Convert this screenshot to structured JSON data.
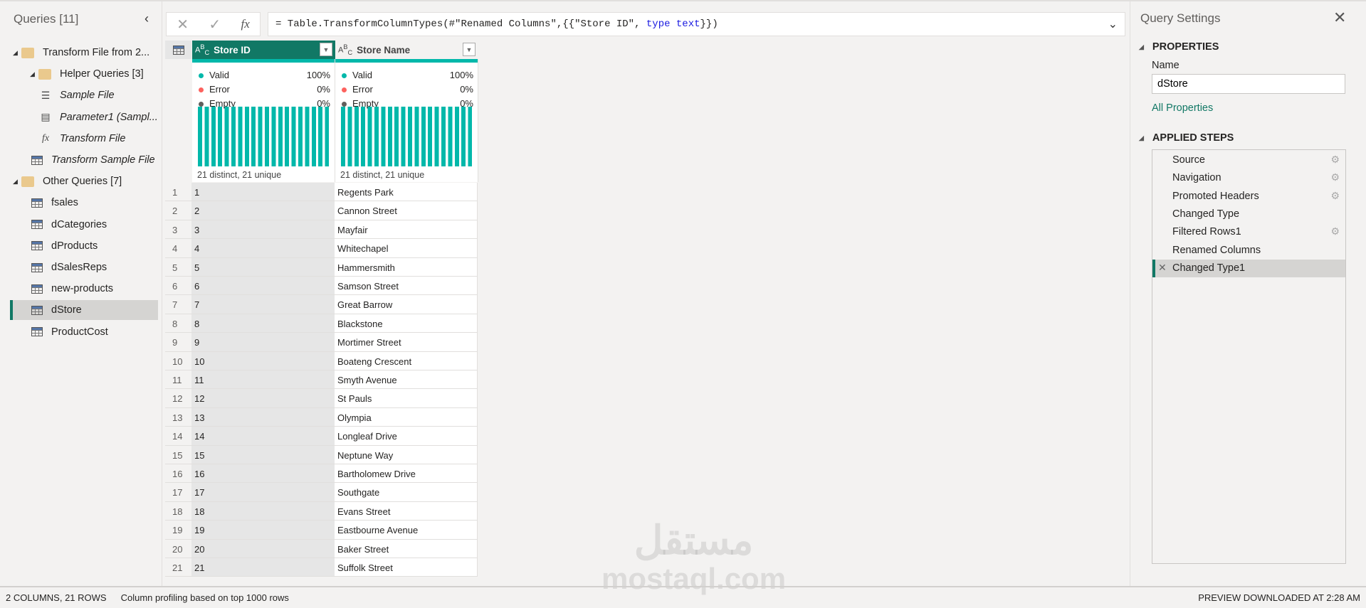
{
  "queries": {
    "title": "Queries [11]",
    "items": [
      {
        "label": "Transform File from 2...",
        "type": "folder",
        "level": 0
      },
      {
        "label": "Helper Queries [3]",
        "type": "folder",
        "level": 1
      },
      {
        "label": "Sample File",
        "type": "doc",
        "level": 2
      },
      {
        "label": "Parameter1 (Sampl...",
        "type": "param",
        "level": 2
      },
      {
        "label": "Transform File",
        "type": "fx",
        "level": 2
      },
      {
        "label": "Transform Sample File",
        "type": "table",
        "level": 1
      },
      {
        "label": "Other Queries [7]",
        "type": "folder",
        "level": 0
      },
      {
        "label": "fsales",
        "type": "table",
        "level": 1
      },
      {
        "label": "dCategories",
        "type": "table",
        "level": 1
      },
      {
        "label": "dProducts",
        "type": "table",
        "level": 1
      },
      {
        "label": "dSalesReps",
        "type": "table",
        "level": 1
      },
      {
        "label": "new-products",
        "type": "table",
        "level": 1
      },
      {
        "label": "dStore",
        "type": "table",
        "level": 1,
        "selected": true
      },
      {
        "label": "ProductCost",
        "type": "table",
        "level": 1
      }
    ]
  },
  "formula": {
    "prefix": "= Table.TransformColumnTypes(#\"Renamed Columns\",{{\"Store ID\", ",
    "kw": "type text",
    "suffix": "}})",
    "fx": "fx"
  },
  "columns": [
    {
      "name": "Store ID",
      "type": "ABC",
      "valid": "100%",
      "error": "0%",
      "empty": "0%",
      "distinct": "21 distinct, 21 unique",
      "selected": true
    },
    {
      "name": "Store Name",
      "type": "ABC",
      "valid": "100%",
      "error": "0%",
      "empty": "0%",
      "distinct": "21 distinct, 21 unique"
    }
  ],
  "profile_labels": {
    "valid": "Valid",
    "error": "Error",
    "empty": "Empty"
  },
  "rows": [
    [
      "1",
      "1",
      "Regents Park"
    ],
    [
      "2",
      "2",
      "Cannon Street"
    ],
    [
      "3",
      "3",
      "Mayfair"
    ],
    [
      "4",
      "4",
      "Whitechapel"
    ],
    [
      "5",
      "5",
      "Hammersmith"
    ],
    [
      "6",
      "6",
      "Samson Street"
    ],
    [
      "7",
      "7",
      "Great Barrow"
    ],
    [
      "8",
      "8",
      "Blackstone"
    ],
    [
      "9",
      "9",
      "Mortimer Street"
    ],
    [
      "10",
      "10",
      "Boateng Crescent"
    ],
    [
      "11",
      "11",
      "Smyth Avenue"
    ],
    [
      "12",
      "12",
      "St Pauls"
    ],
    [
      "13",
      "13",
      "Olympia"
    ],
    [
      "14",
      "14",
      "Longleaf Drive"
    ],
    [
      "15",
      "15",
      "Neptune Way"
    ],
    [
      "16",
      "16",
      "Bartholomew Drive"
    ],
    [
      "17",
      "17",
      "Southgate"
    ],
    [
      "18",
      "18",
      "Evans Street"
    ],
    [
      "19",
      "19",
      "Eastbourne Avenue"
    ],
    [
      "20",
      "20",
      "Baker Street"
    ],
    [
      "21",
      "21",
      "Suffolk Street"
    ]
  ],
  "settings": {
    "title": "Query Settings",
    "properties": "PROPERTIES",
    "name_label": "Name",
    "name_value": "dStore",
    "all_properties": "All Properties",
    "applied_steps": "APPLIED STEPS",
    "steps": [
      {
        "label": "Source",
        "gear": true
      },
      {
        "label": "Navigation",
        "gear": true
      },
      {
        "label": "Promoted Headers",
        "gear": true
      },
      {
        "label": "Changed Type",
        "gear": false
      },
      {
        "label": "Filtered Rows1",
        "gear": true
      },
      {
        "label": "Renamed Columns",
        "gear": false
      },
      {
        "label": "Changed Type1",
        "gear": false,
        "selected": true
      }
    ]
  },
  "status": {
    "left": "2 COLUMNS, 21 ROWS",
    "profiling": "Column profiling based on top 1000 rows",
    "right": "PREVIEW DOWNLOADED AT 2:28 AM"
  },
  "watermark": {
    "arabic": "مستقل",
    "latin": "mostaql.com"
  },
  "colors": {
    "accent": "#117865",
    "valid": "#01b8aa",
    "error": "#fd625e",
    "empty": "#605e5c"
  }
}
